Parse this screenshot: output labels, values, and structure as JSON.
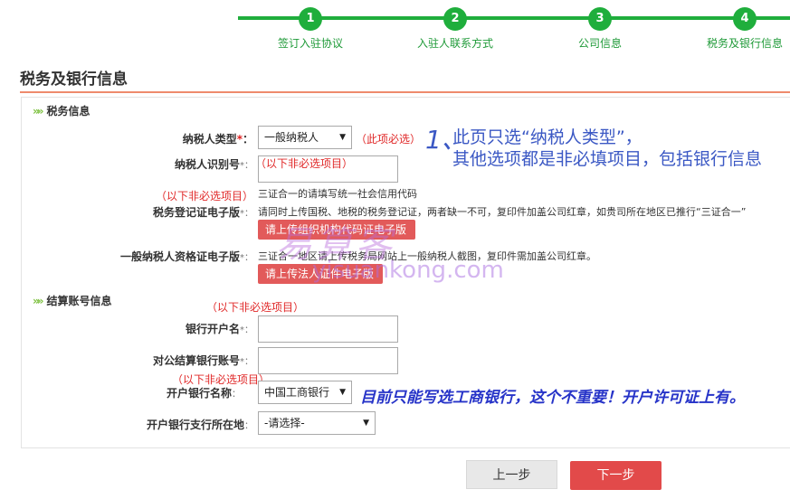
{
  "steps": [
    {
      "number": "1",
      "label": "签订入驻协议"
    },
    {
      "number": "2",
      "label": "入驻人联系方式"
    },
    {
      "number": "3",
      "label": "公司信息"
    },
    {
      "number": "4",
      "label": "税务及银行信息"
    }
  ],
  "page_title": "税务及银行信息",
  "tax_section": {
    "header": "税务信息",
    "arrows": "»»",
    "taxpayer_type": {
      "label": "纳税人类型",
      "required_mark": "*",
      "suffix": "：",
      "value": "一般纳税人",
      "note": "（此项必选）"
    },
    "taxpayer_id": {
      "label": "纳税人识别号",
      "suffix": "*：",
      "note": "（以下非必选项目）"
    },
    "credit_code_hint": "三证合一的请填写统一社会信用代码",
    "reg_cert": {
      "note": "（以下非必选项目）",
      "label": "税务登记证电子版",
      "suffix": "*：",
      "desc": "请同时上传国税、地税的税务登记证，两者缺一不可，复印件加盖公司红章，如贵司所在地区已推行“三证合一”",
      "upload_label": "请上传组织机构代码证电子版"
    },
    "general_cert": {
      "label": "一般纳税人资格证电子版",
      "suffix": "*：",
      "desc": "三证合一地区请上传税务局网站上一般纳税人截图，复印件需加盖公司红章。",
      "upload_label": "请上传法人证件电子版"
    }
  },
  "bank_section": {
    "header": "结算账号信息",
    "arrows": "»»",
    "note": "（以下非必选项目）",
    "account_name": {
      "label": "银行开户名",
      "suffix": "*："
    },
    "account_number": {
      "label": "对公结算银行账号",
      "suffix": "*："
    },
    "bank_name": {
      "note": "（以下非必选项目）",
      "label": "开户银行名称",
      "suffix": "：",
      "value": "中国工商银行"
    },
    "branch_location": {
      "label": "开户银行支行所在地",
      "suffix": "：",
      "value": "-请选择-"
    }
  },
  "annotations": {
    "big_number": "1、",
    "line1": "此页只选“纳税人类型”，",
    "line2": "其他选项都是非必填项目，包括银行信息",
    "bank_note": "目前只能写选工商银行，这个不重要！开户许可证上有。"
  },
  "watermark": {
    "cn": "易算客",
    "url": "yisuankong.com"
  },
  "buttons": {
    "prev": "上一步",
    "next": "下一步"
  },
  "colors": {
    "accent_green": "#1fae3c",
    "accent_red": "#e24a4a",
    "annotation_blue": "#3b58c4"
  }
}
